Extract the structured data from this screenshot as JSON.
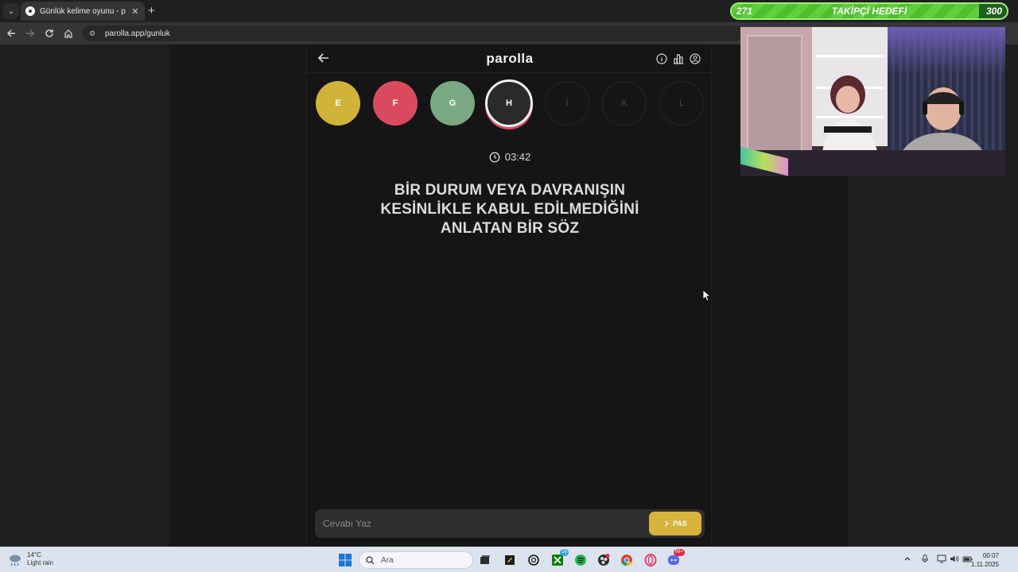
{
  "browser": {
    "tab_title": "Günlük kelime oyunu - parolla",
    "url": "parolla.app/gunluk"
  },
  "app": {
    "logo": "parolla",
    "letters": [
      {
        "letter": "E",
        "state": "correct"
      },
      {
        "letter": "F",
        "state": "wrong"
      },
      {
        "letter": "G",
        "state": "passed"
      },
      {
        "letter": "H",
        "state": "active"
      },
      {
        "letter": "İ",
        "state": "pending"
      },
      {
        "letter": "K",
        "state": "pending"
      },
      {
        "letter": "L",
        "state": "pending"
      }
    ],
    "timer": "03:42",
    "question": "BİR DURUM VEYA DAVRANIŞIN KESİNLİKLE KABUL EDİLMEDİĞİNİ ANLATAN BİR SÖZ",
    "answer_placeholder": "Cevabı Yaz",
    "pass_label": "PAS"
  },
  "overlay": {
    "goal_current": "271",
    "goal_title": "TAKİPÇİ HEDEFİ",
    "goal_target": "300",
    "goal_progress": 0.9
  },
  "taskbar": {
    "weather_temp": "14°C",
    "weather_desc": "Light rain",
    "search_label": "Ara",
    "xbox_badge": "16",
    "discord_badge": "99+",
    "time": "00:07",
    "date": "1.11.2025"
  },
  "colors": {
    "correct": "#d2b33a",
    "wrong": "#d94a5e",
    "passed": "#7aa882",
    "accent": "#d7b33b"
  }
}
